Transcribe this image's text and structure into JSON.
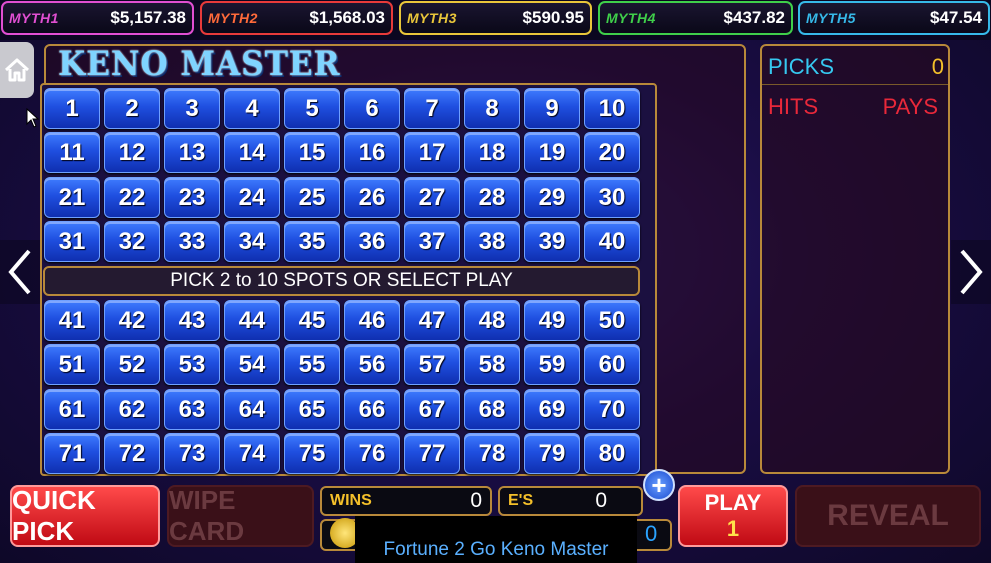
{
  "jackpots": [
    {
      "name": "MYTH1",
      "value": "$5,157.38",
      "color": "#e14fd2"
    },
    {
      "name": "MYTH2",
      "value": "$1,568.03",
      "color": "#e83a3a"
    },
    {
      "name": "MYTH3",
      "value": "$590.95",
      "color": "#e9c63a"
    },
    {
      "name": "MYTH4",
      "value": "$437.82",
      "color": "#3fcf4a"
    },
    {
      "name": "MYTH5",
      "value": "$47.54",
      "color": "#36b9e8"
    }
  ],
  "title": "KENO MASTER",
  "message": "PICK 2 to 10 SPOTS OR SELECT PLAY",
  "paytable": {
    "picks_label": "PICKS",
    "picks_value": "0",
    "hits_label": "HITS",
    "pays_label": "PAYS"
  },
  "controls": {
    "quick_pick": "QUICK PICK",
    "wipe_card": "WIPE CARD",
    "play_label": "PLAY",
    "play_value": "1",
    "reveal": "REVEAL",
    "plus": "+",
    "wins_label": "WINS",
    "wins_value": "0",
    "es_label": "E'S",
    "es_value": "0",
    "credit_value": "0"
  },
  "caption": "Fortune 2 Go Keno Master",
  "icons": {
    "home": "home-icon",
    "left": "chevron-left-icon",
    "right": "chevron-right-icon",
    "cursor": "pointer-icon",
    "coin": "coin-icon"
  }
}
